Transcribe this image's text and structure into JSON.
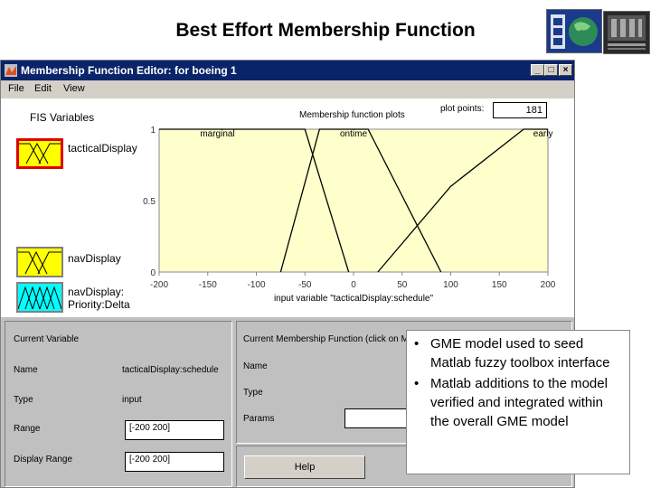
{
  "slide": {
    "title": "Best Effort Membership Function"
  },
  "window": {
    "title": "Membership Function Editor: for boeing 1",
    "minimize_glyph": "_",
    "maximize_glyph": "□",
    "close_glyph": "×"
  },
  "menu": [
    {
      "label": "File"
    },
    {
      "label": "Edit"
    },
    {
      "label": "View"
    }
  ],
  "fis": {
    "label": "FIS Variables",
    "variables": [
      {
        "label": "tacticalDisplay",
        "selected": true
      },
      {
        "label": "navDisplay",
        "selected": false
      },
      {
        "label": "navDisplay:\nPriority:Delta",
        "selected": false
      }
    ]
  },
  "plot": {
    "label": "Membership function plots",
    "plot_points_label": "plot points:",
    "plot_points_value": "181",
    "xlabel": "input variable \"tacticalDisplay:schedule\"",
    "xticks": [
      -200,
      -150,
      -100,
      -50,
      0,
      50,
      100,
      150,
      200
    ],
    "yticks": [
      {
        "value": 0,
        "label": "0"
      },
      {
        "value": 0.5,
        "label": "0.5"
      },
      {
        "value": 1,
        "label": "1"
      }
    ],
    "xlim": [
      -200,
      200
    ],
    "ylim": [
      0,
      1
    ],
    "series": [
      {
        "name": "marginal",
        "points": [
          [
            -200,
            1
          ],
          [
            -50,
            1
          ],
          [
            -5,
            0
          ]
        ],
        "label_at": -140
      },
      {
        "name": "ontime",
        "points": [
          [
            -75,
            0
          ],
          [
            -35,
            1
          ],
          [
            15,
            1
          ],
          [
            90,
            0
          ]
        ],
        "label_at": 0
      },
      {
        "name": "early",
        "points": [
          [
            25,
            0
          ],
          [
            100,
            0.6
          ],
          [
            175,
            1
          ],
          [
            200,
            1
          ]
        ],
        "label_at": 195
      }
    ]
  },
  "current_variable": {
    "title": "Current Variable",
    "name_label": "Name",
    "name_value": "tacticalDisplay:schedule",
    "type_label": "Type",
    "type_value": "input",
    "range_label": "Range",
    "range_value": "[-200 200]",
    "display_range_label": "Display Range",
    "display_range_value": "[-200 200]"
  },
  "current_mf": {
    "title": "Current Membership Function (click on MF to select)",
    "name_label": "Name",
    "type_label": "Type",
    "params_label": "Params",
    "help_label": "Help"
  },
  "bullets": [
    "GME model used to seed Matlab fuzzy toolbox interface",
    "Matlab additions to the model verified and integrated within the overall GME model"
  ],
  "colors": {
    "plot_bg": "#ffffcc",
    "selected_border": "#e00000",
    "title_bar": "#0a246a"
  }
}
